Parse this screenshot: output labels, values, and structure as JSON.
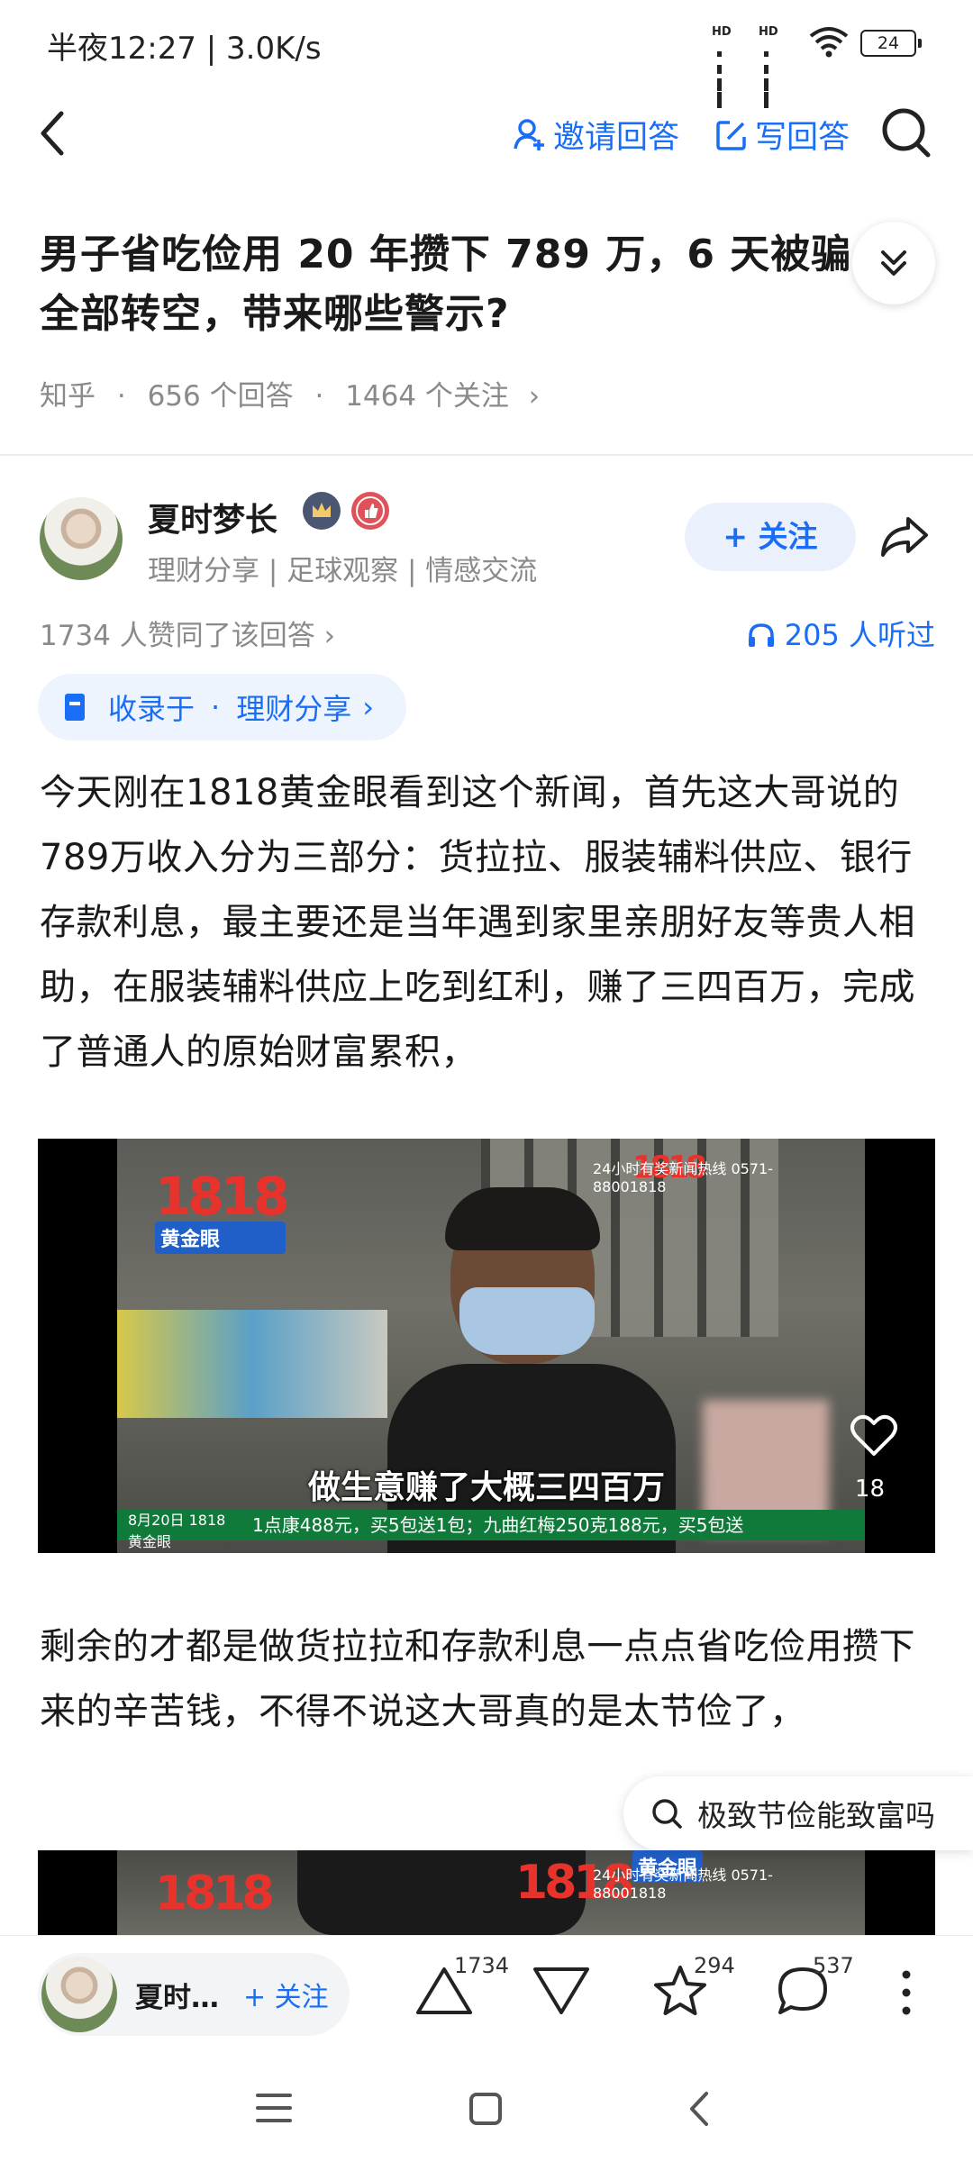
{
  "status_bar": {
    "time": "半夜12:27 | 3.0K/s",
    "battery": "24",
    "hd_label": "HD"
  },
  "nav": {
    "invite_label": "邀请回答",
    "write_label": "写回答"
  },
  "question": {
    "title": "男子省吃俭用 20 年攒下 789 万，6 天被骗全部转空，带来哪些警示?",
    "source": "知乎",
    "answers": "656 个回答",
    "followers": "1464 个关注",
    "sep": "·",
    "more": "›"
  },
  "answer": {
    "author_name": "夏时梦长",
    "author_tags": "理财分享 | 足球观察 | 情感交流",
    "follow_label": "+ 关注",
    "agree_text": "1734 人赞同了该回答 ›",
    "listened_text": "205 人听过",
    "collection_prefix": "收录于",
    "collection_name": "理财分享",
    "paragraph1": "今天刚在1818黄金眼看到这个新闻，首先这大哥说的789万收入分为三部分：货拉拉、服装辅料供应、银行存款利息，最主要还是当年遇到家里亲朋好友等贵人相助，在服装辅料供应上吃到红利，赚了三四百万，完成了普通人的原始财富累积，",
    "paragraph2": "剩余的才都是做货拉拉和存款利息一点点省吃俭用攒下来的辛苦钱，不得不说这大哥真的是太节俭了，"
  },
  "video1": {
    "logo": "1818",
    "logo_sub": "黄金眼",
    "hotline": "24小时有奖新闻热线 0571-88001818",
    "subtitle": "做生意赚了大概三四百万",
    "ticker": "1点康488元，买5包送1包；九曲红梅250克188元，买5包送",
    "date": "8月20日 1818黄金眼",
    "like_count": "18"
  },
  "video2": {
    "logo": "1818",
    "logo_sub": "黄金眼",
    "hotline": "24小时有奖新闻热线 0571-88001818"
  },
  "search_suggestion": "极致节俭能致富吗",
  "bottom_bar": {
    "author_short": "夏时…",
    "follow_label": "+ 关注",
    "upvote_count": "1734",
    "favorite_count": "294",
    "comment_count": "537"
  },
  "colors": {
    "accent": "#1a6ef5",
    "muted": "#8a8a8a"
  }
}
